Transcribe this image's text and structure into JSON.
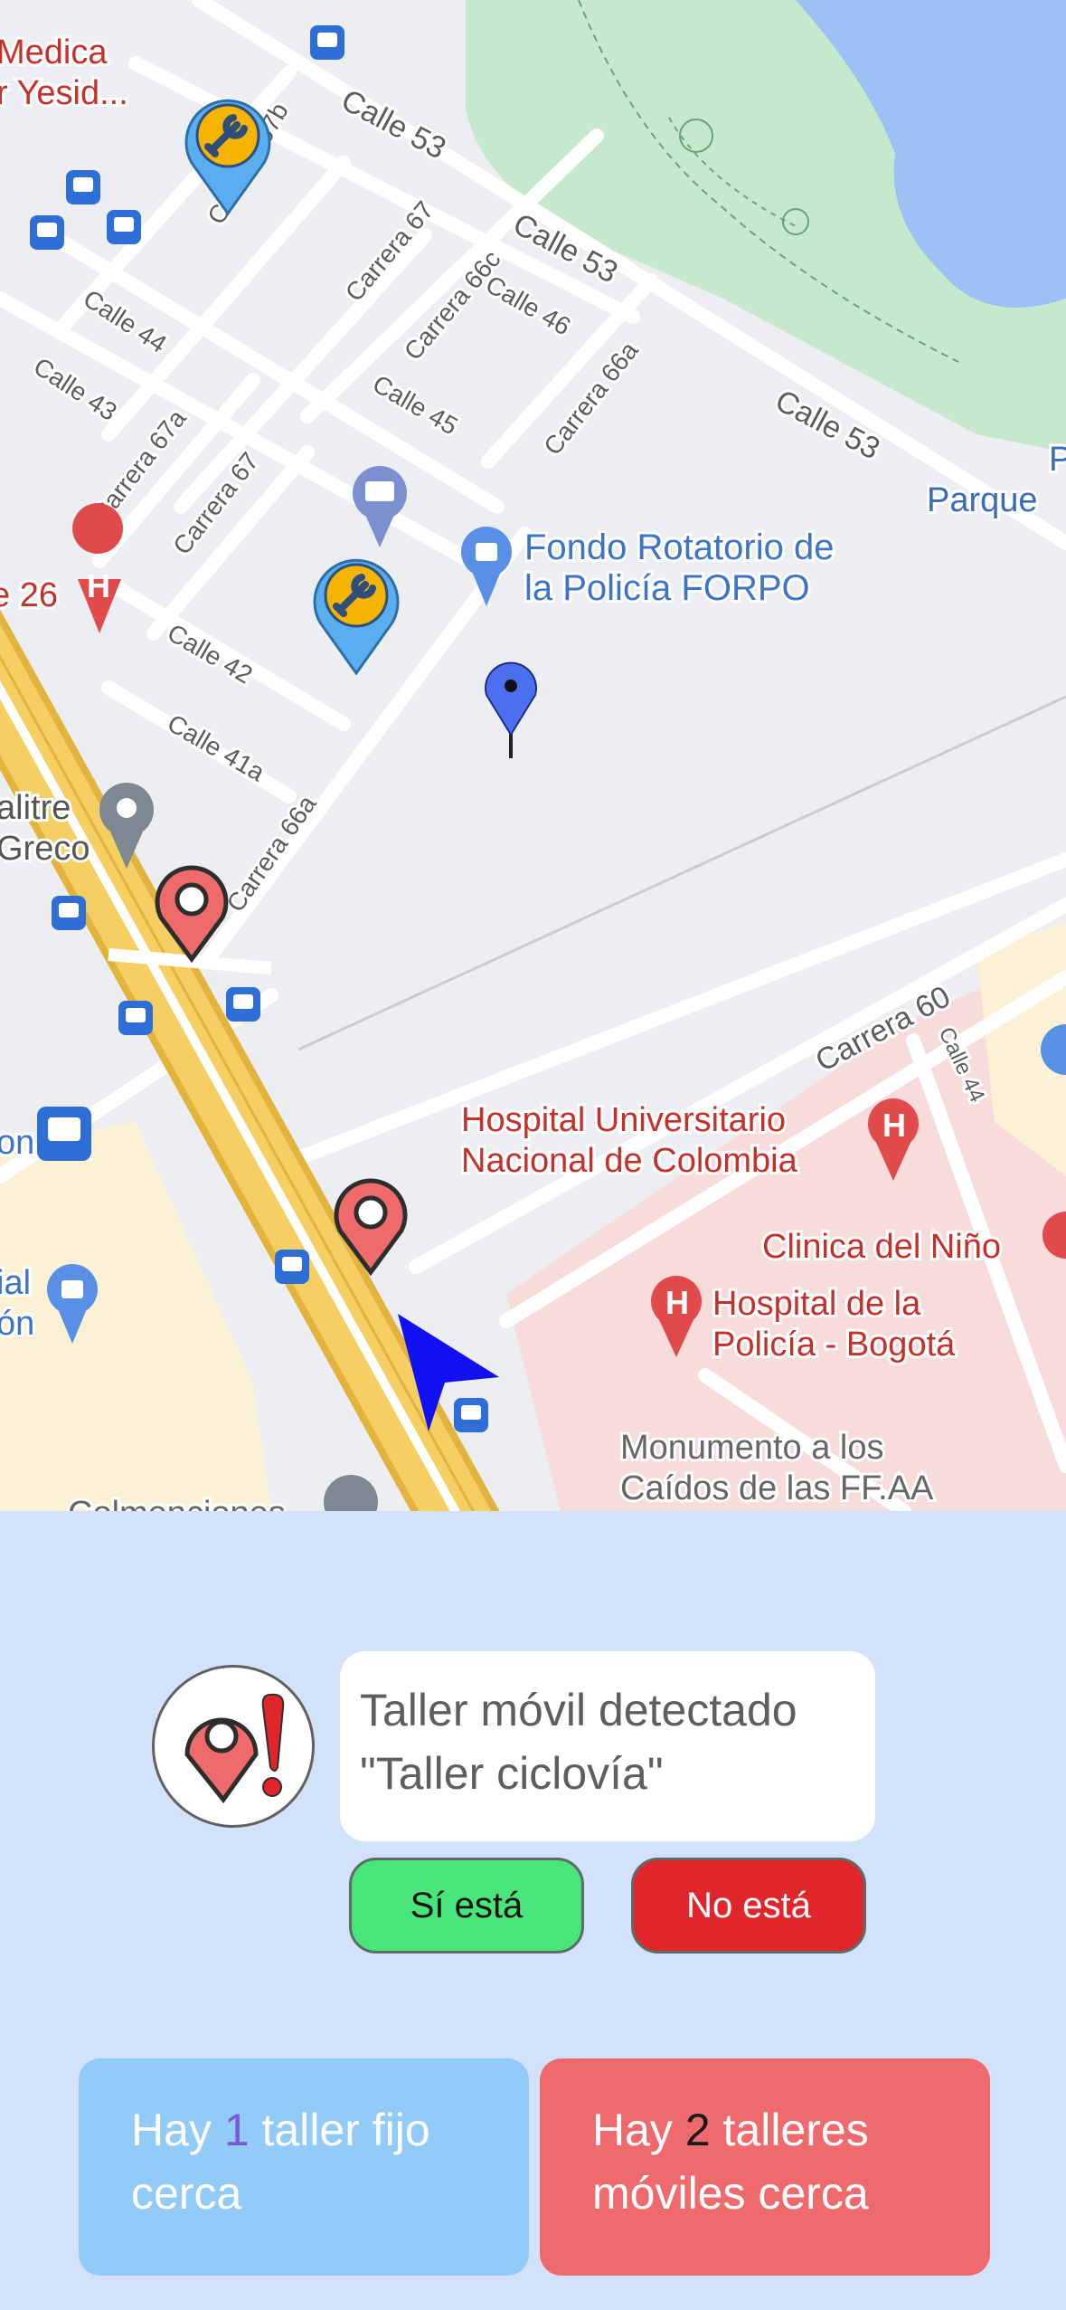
{
  "map": {
    "streets": [
      {
        "text": "Calle 53",
        "id": "s1"
      },
      {
        "text": "Calle 53",
        "id": "s2"
      },
      {
        "text": "Calle 53",
        "id": "s3"
      },
      {
        "text": "Calle 44",
        "id": "s4"
      },
      {
        "text": "Calle 43",
        "id": "s5"
      },
      {
        "text": "Carrera 67b",
        "id": "s6"
      },
      {
        "text": "Carrera 67",
        "id": "s7"
      },
      {
        "text": "Carrera 66c",
        "id": "s8"
      },
      {
        "text": "Calle 46",
        "id": "s9"
      },
      {
        "text": "Carrera 66a",
        "id": "s10"
      },
      {
        "text": "Calle 45",
        "id": "s11"
      },
      {
        "text": "Carrera 67a",
        "id": "s12"
      },
      {
        "text": "Carrera 67",
        "id": "s13"
      },
      {
        "text": "Calle 42",
        "id": "s14"
      },
      {
        "text": "Calle 41a",
        "id": "s15"
      },
      {
        "text": "Carrera 66a",
        "id": "s16"
      },
      {
        "text": "Carrera 60",
        "id": "s17"
      },
      {
        "text": "Calle 44",
        "id": "s18"
      }
    ],
    "places": {
      "medica_1": "Medica",
      "medica_2": "r Yesid...",
      "parque_p": "P",
      "parque": "Parque",
      "forpo_1": "Fondo Rotatorio de",
      "forpo_2": "la Policía FORPO",
      "e26": "e 26",
      "salitre_1": "alitre",
      "salitre_2": "Greco",
      "on": "on",
      "ial_1": "ial",
      "ial_2": "ón",
      "hospital_un_1": "Hospital Universitario",
      "hospital_un_2": "Nacional de Colombia",
      "clinica": "Clinica del Niño",
      "hospital_pol_1": "Hospital de la",
      "hospital_pol_2": "Policía - Bogotá",
      "monumento_1": "Monumento a los",
      "monumento_2": "Caídos de las FF.AA",
      "bottom_cut": "Colmenciones"
    },
    "colors": {
      "road_major": "#f2c54b",
      "park": "#c6e8cc",
      "water": "#9dc0f5",
      "hospital_area": "#f8dcdc",
      "fixed_pin": "#5aaef0",
      "mobile_pin": "#ef6b6b",
      "nav_arrow": "#1010f0"
    }
  },
  "alert": {
    "icon": "mobile-workshop-alert-icon",
    "line1": "Taller móvil detectado",
    "line2": "\"Taller ciclovía\"",
    "yes_label": "Sí está",
    "no_label": "No está"
  },
  "summary": {
    "fixed_prefix": "Hay ",
    "fixed_count": "1",
    "fixed_suffix_1": " taller fijo",
    "fixed_suffix_2": "cerca",
    "mobile_prefix": "Hay ",
    "mobile_count": "2",
    "mobile_suffix_1": " talleres",
    "mobile_suffix_2": "móviles cerca"
  }
}
